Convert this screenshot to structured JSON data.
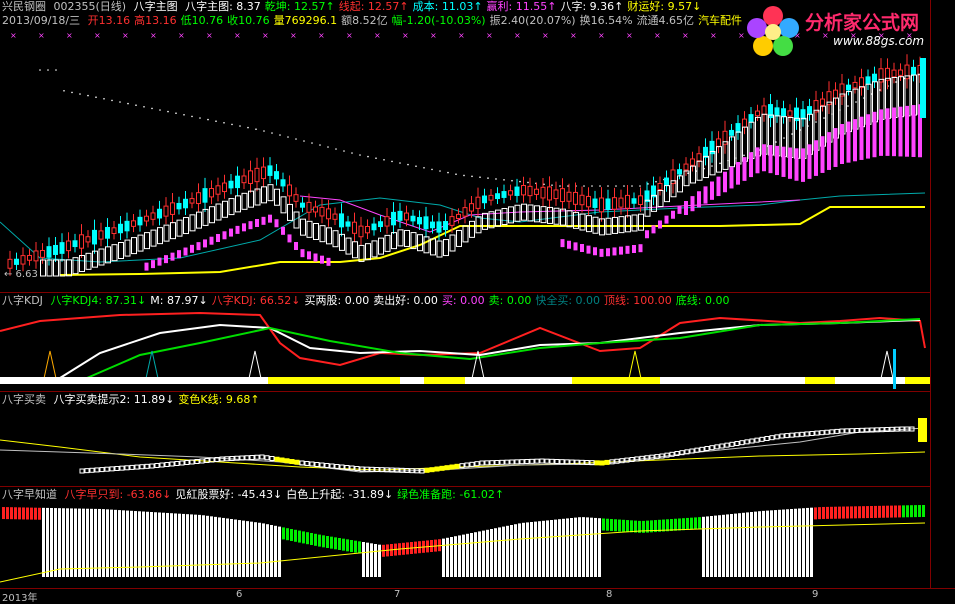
{
  "header1": {
    "stock_name": "兴民钢圈",
    "stock_code": "002355(日线)",
    "indicator": "八字主图",
    "items": [
      {
        "label": "八字主图: 8.37",
        "color": "#ffffff"
      },
      {
        "label": "乾坤: 12.57↑",
        "color": "#00ff00"
      },
      {
        "label": "线起: 12.57↑",
        "color": "#ff3030"
      },
      {
        "label": "成本: 11.03↑",
        "color": "#00ffff"
      },
      {
        "label": "赢利: 11.55↑",
        "color": "#ff44ff"
      },
      {
        "label": "八字: 9.36↑",
        "color": "#ffffff"
      },
      {
        "label": "财运好: 9.57↓",
        "color": "#ffff00"
      }
    ]
  },
  "header2": {
    "date": "2013/09/18/三",
    "items": [
      {
        "label": "开13.16",
        "color": "#ff3030"
      },
      {
        "label": "高13.16",
        "color": "#ff3030"
      },
      {
        "label": "低10.76",
        "color": "#00ff00"
      },
      {
        "label": "收10.76",
        "color": "#00ff00"
      },
      {
        "label": "量769296.1",
        "color": "#ffff00"
      },
      {
        "label": "额8.52亿",
        "color": "#c0c0c0"
      },
      {
        "label": "幅-1.20(-10.03%)",
        "color": "#00ff00"
      },
      {
        "label": "振2.40(20.07%)",
        "color": "#c0c0c0"
      },
      {
        "label": "换16.54%",
        "color": "#c0c0c0"
      },
      {
        "label": "流通4.65亿",
        "color": "#c0c0c0"
      },
      {
        "label": "汽车配件",
        "color": "#ffff00"
      }
    ]
  },
  "main_chart": {
    "low_label": "← 6.63"
  },
  "kdj_pane": {
    "title": "八字KDJ",
    "items": [
      {
        "label": "八字KDJ4: 87.31↓",
        "color": "#00ff00"
      },
      {
        "label": "M: 87.97↓",
        "color": "#ffffff"
      },
      {
        "label": "八字KDJ: 66.52↓",
        "color": "#ff3030"
      },
      {
        "label": "买两股: 0.00",
        "color": "#ffffff"
      },
      {
        "label": "卖出好: 0.00",
        "color": "#ffffff"
      },
      {
        "label": "买: 0.00",
        "color": "#ff44ff"
      },
      {
        "label": "卖: 0.00",
        "color": "#00ff00"
      },
      {
        "label": "快全买: 0.00",
        "color": "#008080"
      },
      {
        "label": "顶线: 100.00",
        "color": "#ff3030"
      },
      {
        "label": "底线: 0.00",
        "color": "#00ff00"
      }
    ]
  },
  "trade_pane": {
    "title": "八字买卖",
    "items": [
      {
        "label": "八字买卖提示2: 11.89↓",
        "color": "#ffffff"
      },
      {
        "label": "变色K线: 9.68↑",
        "color": "#ffff00"
      }
    ]
  },
  "early_pane": {
    "title": "八字早知道",
    "items": [
      {
        "label": "八字早只到: -63.86↓",
        "color": "#ff3030"
      },
      {
        "label": "见紅股票好: -45.43↓",
        "color": "#ffffff"
      },
      {
        "label": "白色上升起: -31.89↓",
        "color": "#ffffff"
      },
      {
        "label": "绿色准备跑: -61.02↑",
        "color": "#00ff00"
      }
    ]
  },
  "x_axis": {
    "labels": [
      "2013年",
      "6",
      "7",
      "8",
      "9"
    ]
  },
  "logo": {
    "name": "分析家公式网",
    "url": "www.88gs.com"
  }
}
